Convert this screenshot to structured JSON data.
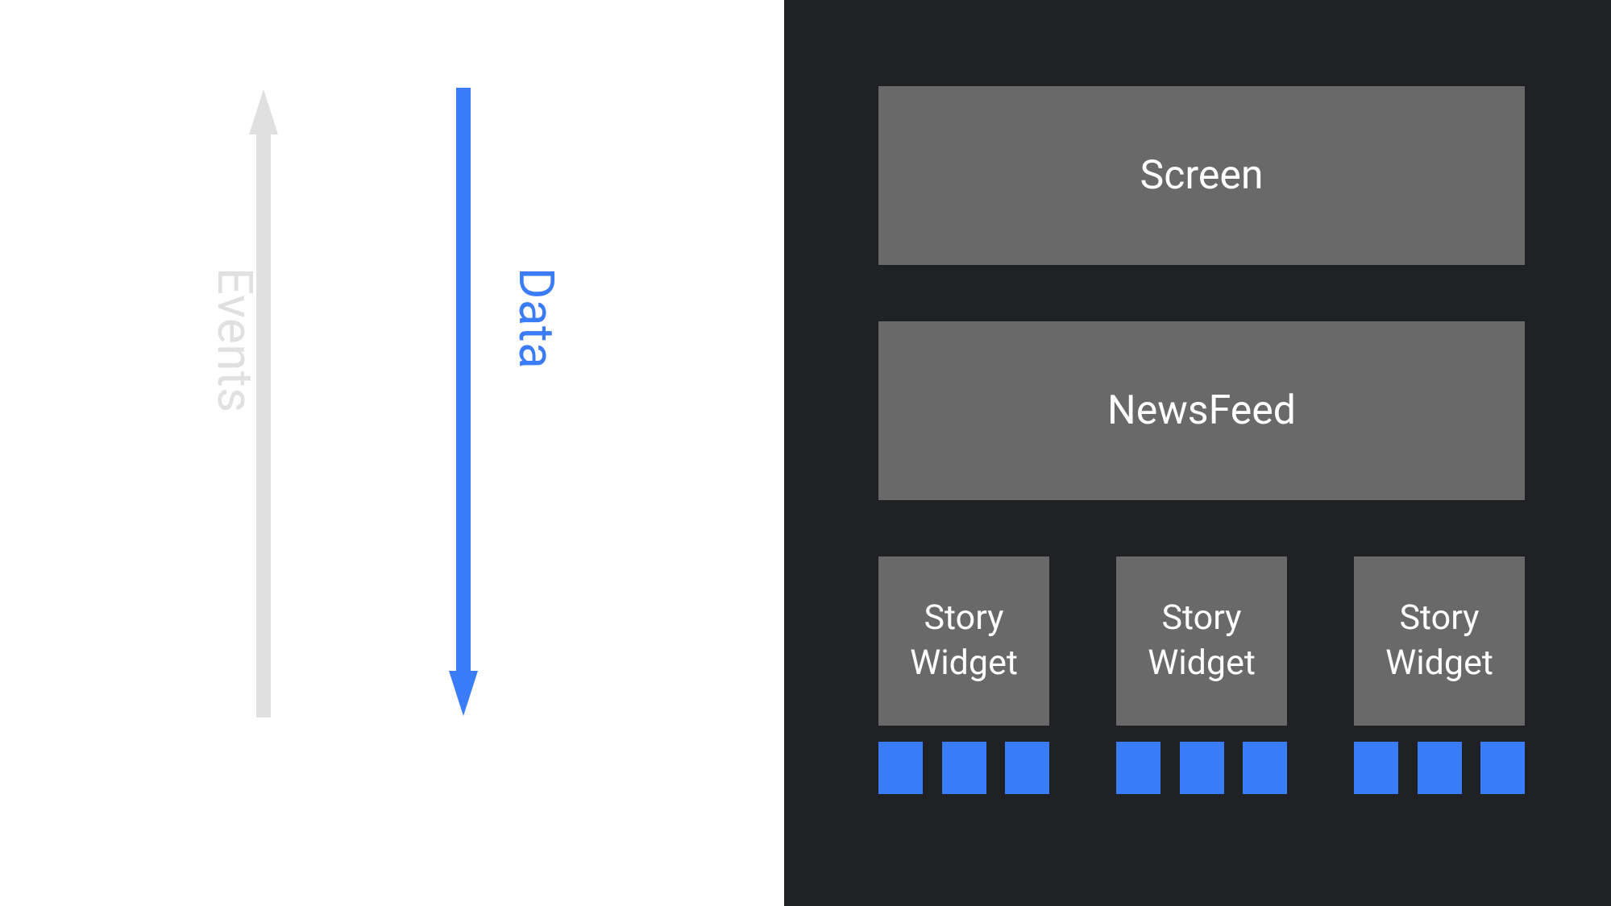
{
  "colors": {
    "blue": "#3b7cfa",
    "lightGray": "#e0e0e0",
    "darkBg": "#202124",
    "boxGray": "#696969"
  },
  "leftPanel": {
    "eventsLabel": "Events",
    "dataLabel": "Data"
  },
  "rightPanel": {
    "screenLabel": "Screen",
    "newsfeedLabel": "NewsFeed",
    "storyWidgets": [
      {
        "label": "Story\nWidget"
      },
      {
        "label": "Story\nWidget"
      },
      {
        "label": "Story\nWidget"
      }
    ],
    "blueBarGroups": 3,
    "barsPerGroup": 3
  }
}
